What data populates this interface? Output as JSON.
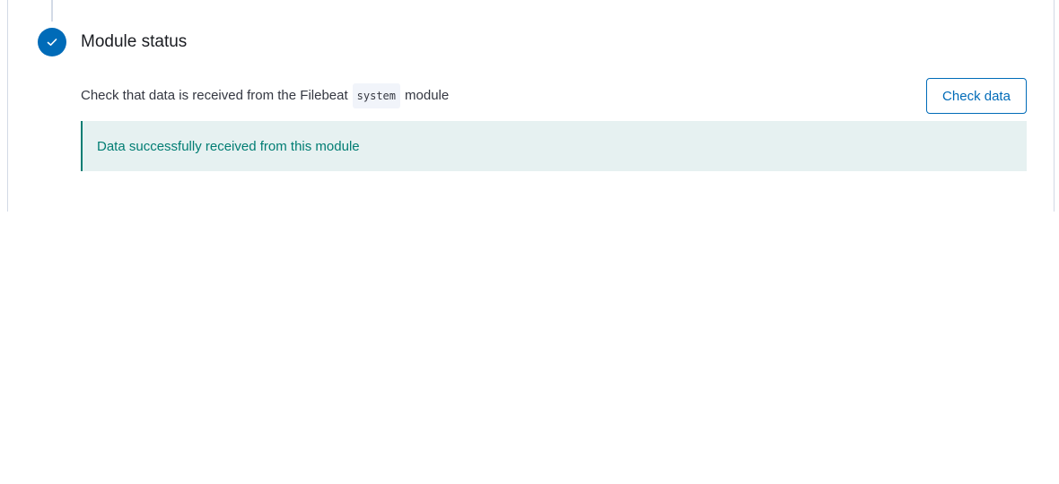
{
  "step": {
    "title": "Module status",
    "icon": "check-icon",
    "status_color": "#006bb8"
  },
  "description": {
    "prefix": "Check that data is received from the Filebeat",
    "module_code": "system",
    "suffix": "module"
  },
  "check_button": {
    "label": "Check data"
  },
  "callout": {
    "message": "Data successfully received from this module",
    "color": "#017d73"
  }
}
